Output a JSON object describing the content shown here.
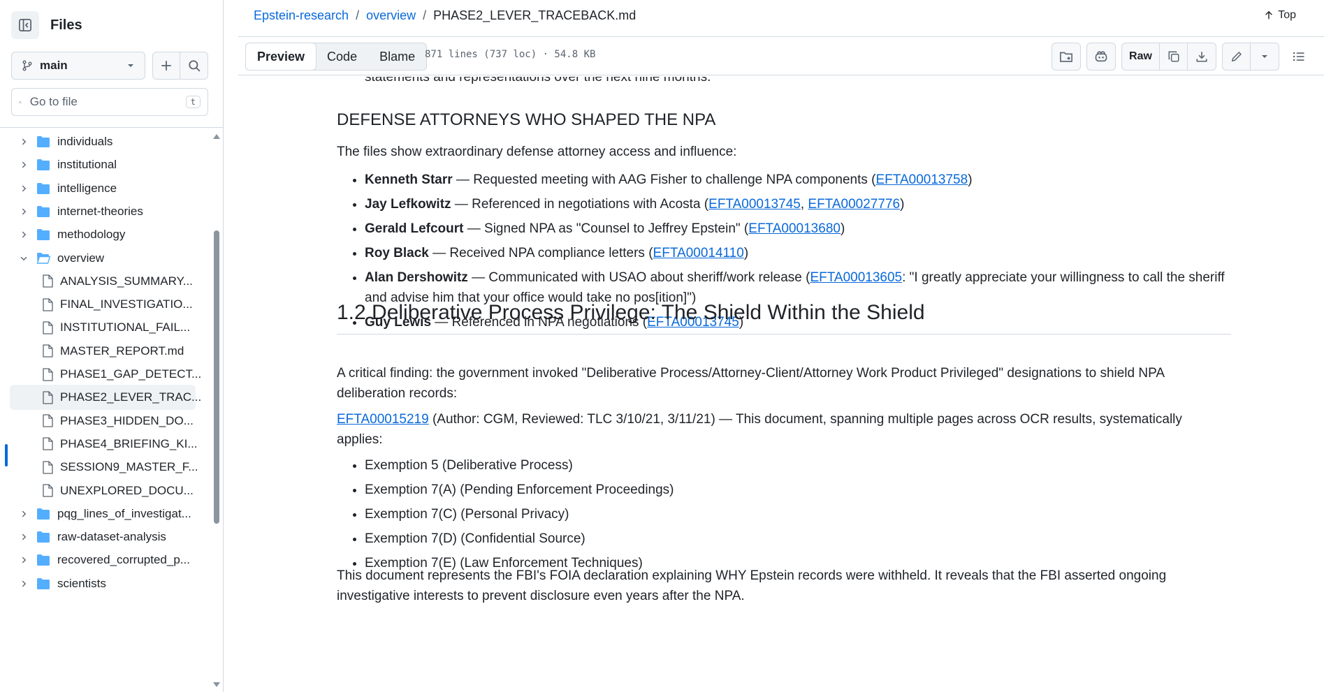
{
  "sidebar": {
    "title": "Files",
    "branch": "main",
    "search_placeholder": "Go to file",
    "search_shortcut": "t",
    "tree": [
      {
        "name": "individuals",
        "type": "folder",
        "expanded": false
      },
      {
        "name": "institutional",
        "type": "folder",
        "expanded": false
      },
      {
        "name": "intelligence",
        "type": "folder",
        "expanded": false
      },
      {
        "name": "internet-theories",
        "type": "folder",
        "expanded": false
      },
      {
        "name": "methodology",
        "type": "folder",
        "expanded": false
      },
      {
        "name": "overview",
        "type": "folder",
        "expanded": true
      },
      {
        "name": "ANALYSIS_SUMMARY...",
        "type": "file"
      },
      {
        "name": "FINAL_INVESTIGATIO...",
        "type": "file"
      },
      {
        "name": "INSTITUTIONAL_FAIL...",
        "type": "file"
      },
      {
        "name": "MASTER_REPORT.md",
        "type": "file"
      },
      {
        "name": "PHASE1_GAP_DETECT...",
        "type": "file"
      },
      {
        "name": "PHASE2_LEVER_TRAC...",
        "type": "file",
        "selected": true
      },
      {
        "name": "PHASE3_HIDDEN_DO...",
        "type": "file"
      },
      {
        "name": "PHASE4_BRIEFING_KI...",
        "type": "file"
      },
      {
        "name": "SESSION9_MASTER_F...",
        "type": "file"
      },
      {
        "name": "UNEXPLORED_DOCU...",
        "type": "file"
      },
      {
        "name": "pqg_lines_of_investigat...",
        "type": "folder",
        "expanded": false
      },
      {
        "name": "raw-dataset-analysis",
        "type": "folder",
        "expanded": false
      },
      {
        "name": "recovered_corrupted_p...",
        "type": "folder",
        "expanded": false
      },
      {
        "name": "scientists",
        "type": "folder",
        "expanded": false
      }
    ]
  },
  "header": {
    "breadcrumb": [
      "Epstein-research",
      "overview",
      "PHASE2_LEVER_TRACEBACK.md"
    ],
    "top_label": "Top"
  },
  "toolbar": {
    "tabs": [
      "Preview",
      "Code",
      "Blame"
    ],
    "active_tab": "Preview",
    "file_meta": "871 lines (737 loc) · 54.8 KB",
    "raw_label": "Raw"
  },
  "article": {
    "cut_text": "statements and representations over the next nine months.",
    "heading1": "DEFENSE ATTORNEYS WHO SHAPED THE NPA",
    "intro1": "The files show extraordinary defense attorney access and influence:",
    "attorneys": [
      {
        "name": "Kenneth Starr",
        "pre": " — Requested meeting with AAG Fisher to challenge NPA components (",
        "refs": [
          "EFTA00013758"
        ],
        "post": ")"
      },
      {
        "name": "Jay Lefkowitz",
        "pre": " — Referenced in negotiations with Acosta (",
        "refs": [
          "EFTA00013745",
          "EFTA00027776"
        ],
        "post": ")"
      },
      {
        "name": "Gerald Lefcourt",
        "pre": " — Signed NPA as \"Counsel to Jeffrey Epstein\" (",
        "refs": [
          "EFTA00013680"
        ],
        "post": ")"
      },
      {
        "name": "Roy Black",
        "pre": " — Received NPA compliance letters (",
        "refs": [
          "EFTA00014110"
        ],
        "post": ")"
      },
      {
        "name": "Alan Dershowitz",
        "pre": " — Communicated with USAO about sheriff/work release (",
        "refs": [
          "EFTA00013605"
        ],
        "post": ": \"I greatly appreciate your willingness to call the sheriff and advise him that your office would take no pos[ition]\")"
      },
      {
        "name": "Guy Lewis",
        "pre": " — Referenced in NPA negotiations (",
        "refs": [
          "EFTA00013745"
        ],
        "post": ")"
      }
    ],
    "heading2": "1.2 Deliberative Process Privilege: The Shield Within the Shield",
    "para1": "A critical finding: the government invoked \"Deliberative Process/Attorney-Client/Attorney Work Product Privileged\" designations to shield NPA deliberation records:",
    "para2_ref": "EFTA00015219",
    "para2_text": " (Author: CGM, Reviewed: TLC 3/10/21, 3/11/21) — This document, spanning multiple pages across OCR results, systematically applies:",
    "exemptions": [
      "Exemption 5 (Deliberative Process)",
      "Exemption 7(A) (Pending Enforcement Proceedings)",
      "Exemption 7(C) (Personal Privacy)",
      "Exemption 7(D) (Confidential Source)",
      "Exemption 7(E) (Law Enforcement Techniques)"
    ],
    "para3": "This document represents the FBI's FOIA declaration explaining WHY Epstein records were withheld. It reveals that the FBI asserted ongoing investigative interests to prevent disclosure even years after the NPA."
  }
}
